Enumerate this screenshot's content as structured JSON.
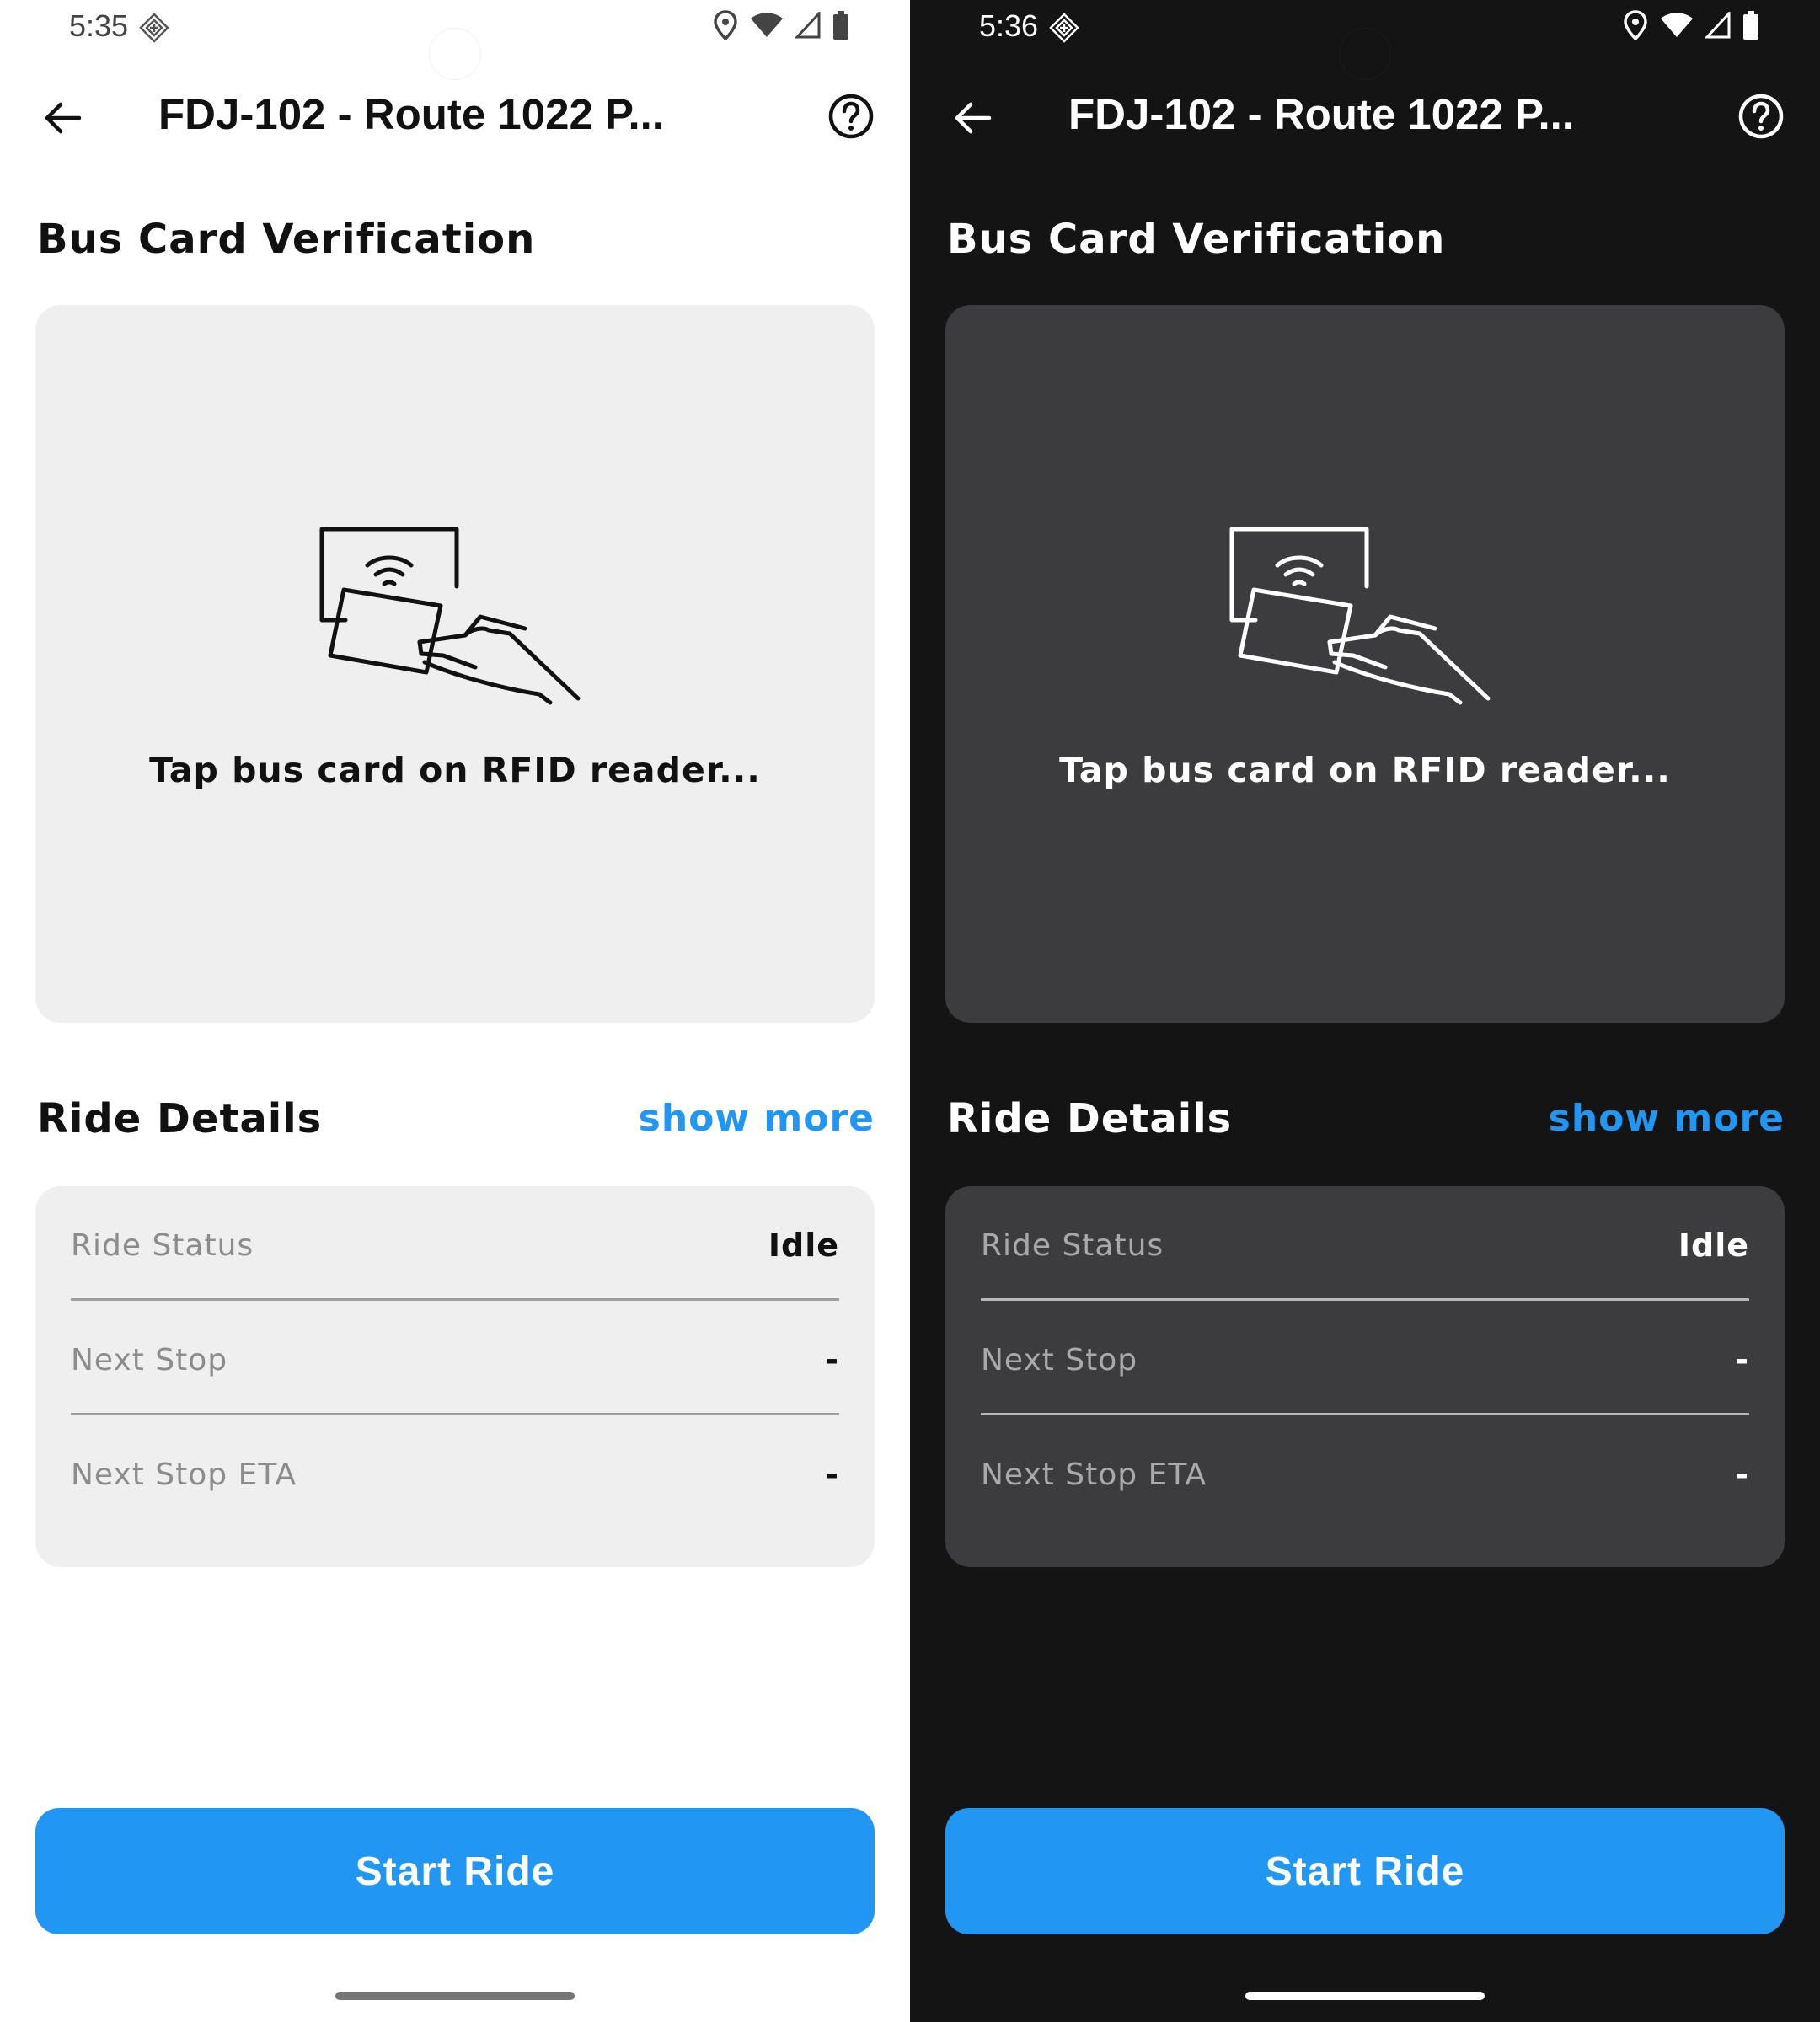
{
  "screens": [
    {
      "theme": "light",
      "status_bar": {
        "time": "5:35"
      },
      "app_bar": {
        "title": "FDJ-102 - Route 1022 P..."
      },
      "verification": {
        "heading": "Bus Card Verification",
        "instruction": "Tap bus card on RFID reader..."
      },
      "ride_details": {
        "heading": "Ride Details",
        "show_more": "show more",
        "rows": [
          {
            "label": "Ride Status",
            "value": "Idle"
          },
          {
            "label": "Next Stop",
            "value": "-"
          },
          {
            "label": "Next Stop ETA",
            "value": "-"
          }
        ]
      },
      "start_button": "Start Ride"
    },
    {
      "theme": "dark",
      "status_bar": {
        "time": "5:36"
      },
      "app_bar": {
        "title": "FDJ-102 - Route 1022 P..."
      },
      "verification": {
        "heading": "Bus Card Verification",
        "instruction": "Tap bus card on RFID reader..."
      },
      "ride_details": {
        "heading": "Ride Details",
        "show_more": "show more",
        "rows": [
          {
            "label": "Ride Status",
            "value": "Idle"
          },
          {
            "label": "Next Stop",
            "value": "-"
          },
          {
            "label": "Next Stop ETA",
            "value": "-"
          }
        ]
      },
      "start_button": "Start Ride"
    }
  ],
  "icons": [
    "arrow-left-icon",
    "help-circle-icon",
    "rfid-card-tap-icon",
    "location-pin-icon",
    "wifi-icon",
    "cell-signal-icon",
    "battery-icon",
    "sync-diamond-icon"
  ],
  "colors": {
    "accent": "#2196f3",
    "light_background": "#ffffff",
    "dark_background": "#141414",
    "light_card": "#efefef",
    "dark_card": "#3c3c3f"
  }
}
